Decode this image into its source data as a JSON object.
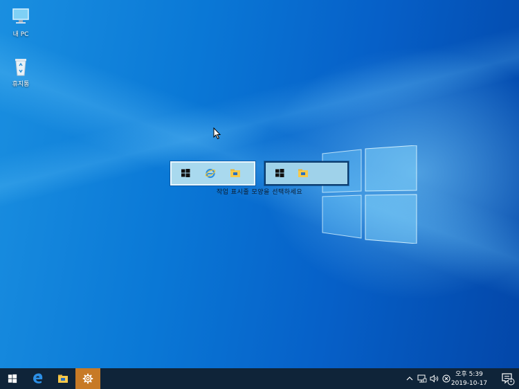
{
  "desktop": {
    "icons": [
      {
        "label": "내 PC",
        "icon": "computer-icon"
      },
      {
        "label": "휴지통",
        "icon": "recycle-bin-icon"
      }
    ]
  },
  "dialog": {
    "caption": "작업 표시줄 모양을 선택하세요",
    "options": [
      {
        "icons": [
          "windows-logo-icon",
          "internet-explorer-icon",
          "file-explorer-icon"
        ]
      },
      {
        "icons": [
          "windows-logo-icon",
          "file-explorer-icon"
        ]
      }
    ]
  },
  "taskbar": {
    "buttons": [
      "start-button",
      "edge-icon",
      "file-explorer-icon",
      "settings-icon"
    ],
    "tray": {
      "icons": [
        "chevron-up-icon",
        "network-icon",
        "volume-icon",
        "close-circle-icon"
      ],
      "time": "오후 5:39",
      "date": "2019-10-17",
      "notification_count": "1"
    }
  },
  "colors": {
    "desktop": "#0a78d6",
    "taskbar": "#0f2439",
    "active_button": "#c77a26"
  }
}
